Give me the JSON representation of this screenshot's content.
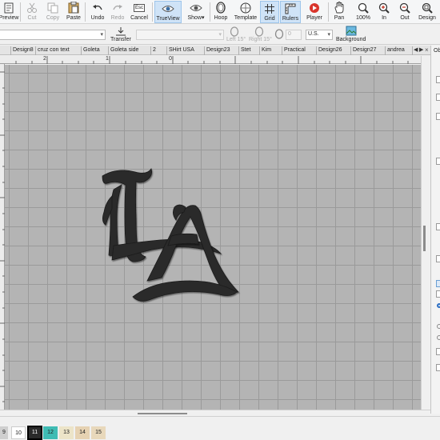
{
  "toolbar": {
    "preview": "Preview",
    "cut": "Cut",
    "copy": "Copy",
    "paste": "Paste",
    "undo": "Undo",
    "redo": "Redo",
    "cancel": "Cancel",
    "cancel_key": "Esc",
    "trueview": "TrueView",
    "show": "Show",
    "hoop": "Hoop",
    "template": "Template",
    "grid": "Grid",
    "rulers": "Rulers",
    "player": "Player",
    "pan": "Pan",
    "zoom_100": "100%",
    "zoom_in": "In",
    "zoom_out": "Out",
    "design": "Design"
  },
  "propbar": {
    "transfer": "Transfer",
    "left_angle": "Left 15°",
    "right_angle": "Right 15°",
    "rotate_value": "0",
    "units": "U.S.",
    "background": "Background"
  },
  "tabs": [
    "Design8",
    "cruz con text",
    "Goleta",
    "Goleta side",
    "2",
    "SHirt USA",
    "Design23",
    "Stet",
    "Kim",
    "Practical",
    "Design26",
    "Design27",
    "andrea"
  ],
  "tab_close_glyph": "×",
  "right_panel": {
    "title_fragment": "Ob"
  },
  "ruler": {
    "h_labels": [
      "2",
      "1",
      "0"
    ],
    "v_labels": [
      "2",
      "1",
      "0",
      "1",
      "2"
    ]
  },
  "colors": {
    "canvas_bg": "#b4b4b4",
    "grid": "#9a9a9a",
    "embroidery": "#2b2b2b",
    "active_tool": "#cfe3f7",
    "active_swatch": "#2a2a2a",
    "teal_swatch": "#3fbcb4",
    "cream_swatch": "#ece4c8",
    "tan_swatch": "#e6d2b2"
  },
  "palette": [
    {
      "label": "9",
      "color": "#cfcfcf"
    },
    {
      "label": "10",
      "color": "#ffffff"
    },
    {
      "label": "11",
      "color": "#2a2a2a",
      "selected": true
    },
    {
      "label": "12",
      "color": "#3fbcb4"
    },
    {
      "label": "13",
      "color": "#ece4c8"
    },
    {
      "label": "14",
      "color": "#e6d2b2"
    },
    {
      "label": "15",
      "color": "#e8d8bb"
    }
  ],
  "design": {
    "letters": "LA"
  }
}
